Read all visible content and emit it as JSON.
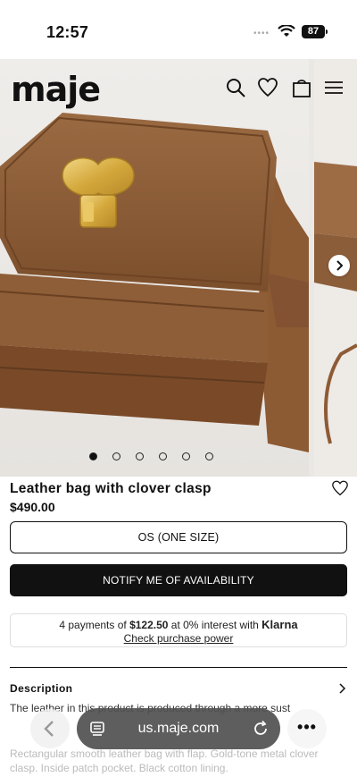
{
  "status_bar": {
    "time": "12:57",
    "battery": "87"
  },
  "header": {
    "logo": "maje",
    "icons": [
      "search-icon",
      "heart-icon",
      "bag-icon",
      "menu-icon"
    ]
  },
  "carousel": {
    "slide_count": 6,
    "active_index": 0
  },
  "product": {
    "title": "Leather bag with clover clasp",
    "price": "$490.00",
    "size_label": "OS (ONE SIZE)",
    "notify_label": "NOTIFY ME OF AVAILABILITY"
  },
  "klarna": {
    "prefix": "4 payments of ",
    "amount": "$122.50",
    "middle": " at 0% interest with ",
    "brand": "Klarna",
    "link": "Check purchase power"
  },
  "description": {
    "heading": "Description",
    "text1": "The leather in this product is produced through a more sust",
    "text2": "Rectangular smooth leather bag with flap. Gold-tone metal clover clasp. Inside patch pocket. Black cotton lining."
  },
  "browser": {
    "url": "us.maje.com",
    "more": "•••"
  },
  "colors": {
    "accent": "#111111",
    "leather": "#8a5a35",
    "gold": "#d9b24a"
  }
}
